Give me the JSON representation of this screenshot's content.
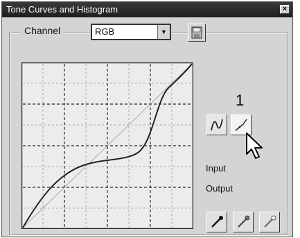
{
  "window": {
    "title": "Tone Curves and Histogram",
    "close_symbol": "×"
  },
  "channel": {
    "label": "Channel",
    "selected": "RGB"
  },
  "side_panel": {
    "annotation_number": "1",
    "input_label": "Input",
    "output_label": "Output"
  },
  "icons": {
    "save": "save-icon",
    "curve_mode": "curve-tool-icon",
    "line_mode": "line-tool-icon",
    "cursor": "mouse-pointer-icon",
    "droppers": [
      "black-point-dropper-icon",
      "gray-point-dropper-icon",
      "white-point-dropper-icon"
    ]
  },
  "colors": {
    "title_bar": "#2a2a2a",
    "panel": "#d4d4d4"
  }
}
